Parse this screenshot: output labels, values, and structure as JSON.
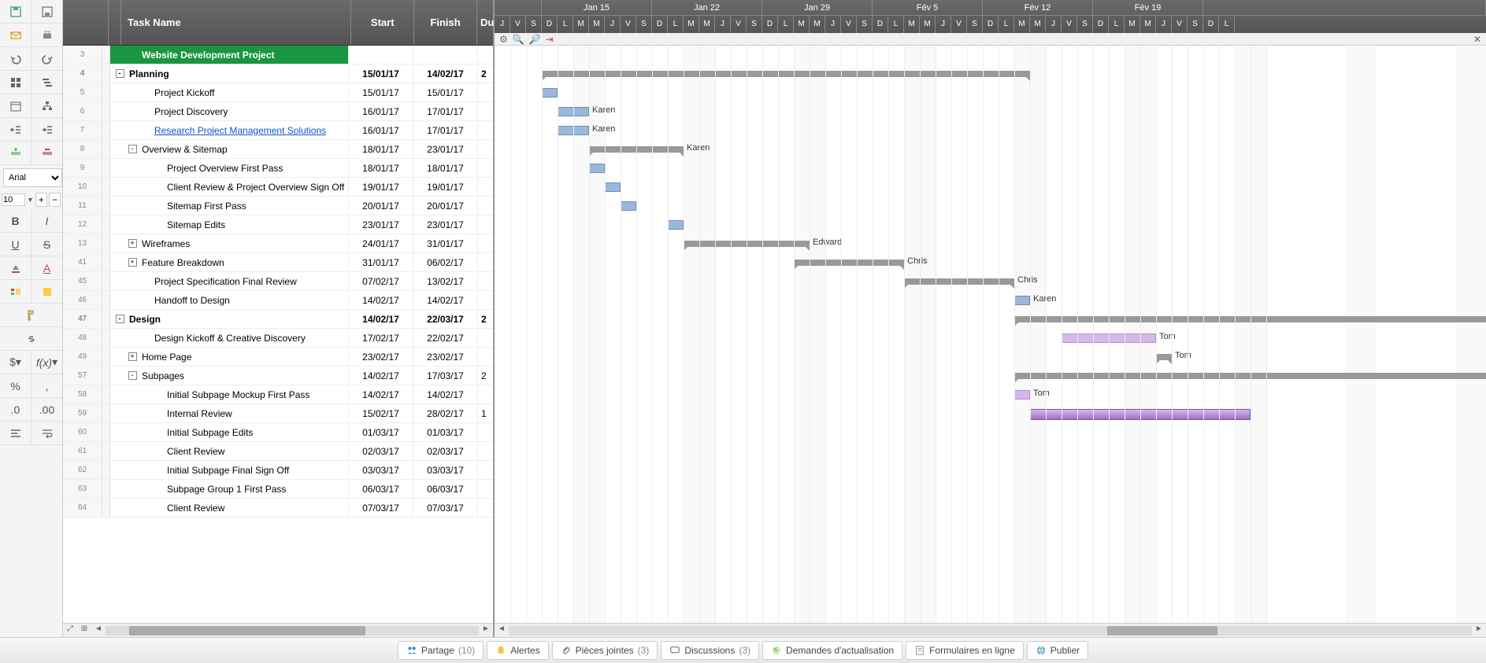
{
  "toolbar": {
    "font": "Arial",
    "size": "10"
  },
  "grid_headers": {
    "task": "Task Name",
    "start": "Start",
    "finish": "Finish",
    "duration": "Du"
  },
  "rows": [
    {
      "num": "3",
      "indent": 1,
      "title": true,
      "task": "Website Development Project",
      "start": "",
      "finish": "",
      "dur": ""
    },
    {
      "num": "4",
      "indent": 0,
      "bold": true,
      "expand": "-",
      "task": "Planning",
      "start": "15/01/17",
      "finish": "14/02/17",
      "dur": "2"
    },
    {
      "num": "5",
      "indent": 2,
      "task": "Project Kickoff",
      "start": "15/01/17",
      "finish": "15/01/17",
      "dur": ""
    },
    {
      "num": "6",
      "indent": 2,
      "task": "Project Discovery",
      "start": "16/01/17",
      "finish": "17/01/17",
      "dur": ""
    },
    {
      "num": "7",
      "indent": 2,
      "link": true,
      "task": "Research Project Management Solutions",
      "start": "16/01/17",
      "finish": "17/01/17",
      "dur": ""
    },
    {
      "num": "8",
      "indent": 1,
      "expand": "-",
      "task": "Overview & Sitemap",
      "start": "18/01/17",
      "finish": "23/01/17",
      "dur": ""
    },
    {
      "num": "9",
      "indent": 3,
      "task": "Project Overview First Pass",
      "start": "18/01/17",
      "finish": "18/01/17",
      "dur": ""
    },
    {
      "num": "10",
      "indent": 3,
      "task": "Client Review & Project Overview Sign Off",
      "start": "19/01/17",
      "finish": "19/01/17",
      "dur": ""
    },
    {
      "num": "11",
      "indent": 3,
      "task": "Sitemap First Pass",
      "start": "20/01/17",
      "finish": "20/01/17",
      "dur": ""
    },
    {
      "num": "12",
      "indent": 3,
      "task": "Sitemap Edits",
      "start": "23/01/17",
      "finish": "23/01/17",
      "dur": ""
    },
    {
      "num": "13",
      "indent": 1,
      "expand": "+",
      "task": "Wireframes",
      "start": "24/01/17",
      "finish": "31/01/17",
      "dur": ""
    },
    {
      "num": "41",
      "indent": 1,
      "expand": "+",
      "task": "Feature Breakdown",
      "start": "31/01/17",
      "finish": "06/02/17",
      "dur": ""
    },
    {
      "num": "45",
      "indent": 2,
      "task": "Project Specification Final Review",
      "start": "07/02/17",
      "finish": "13/02/17",
      "dur": ""
    },
    {
      "num": "46",
      "indent": 2,
      "task": "Handoff to Design",
      "start": "14/02/17",
      "finish": "14/02/17",
      "dur": ""
    },
    {
      "num": "47",
      "indent": 0,
      "bold": true,
      "expand": "-",
      "task": "Design",
      "start": "14/02/17",
      "finish": "22/03/17",
      "dur": "2"
    },
    {
      "num": "48",
      "indent": 2,
      "task": "Design Kickoff & Creative Discovery",
      "start": "17/02/17",
      "finish": "22/02/17",
      "dur": ""
    },
    {
      "num": "49",
      "indent": 1,
      "expand": "+",
      "task": "Home Page",
      "start": "23/02/17",
      "finish": "23/02/17",
      "dur": ""
    },
    {
      "num": "57",
      "indent": 1,
      "expand": "-",
      "task": "Subpages",
      "start": "14/02/17",
      "finish": "17/03/17",
      "dur": "2"
    },
    {
      "num": "58",
      "indent": 3,
      "task": "Initial Subpage Mockup First Pass",
      "start": "14/02/17",
      "finish": "14/02/17",
      "dur": ""
    },
    {
      "num": "59",
      "indent": 3,
      "task": "Internal Review",
      "start": "15/02/17",
      "finish": "28/02/17",
      "dur": "1"
    },
    {
      "num": "60",
      "indent": 3,
      "task": "Initial Subpage Edits",
      "start": "01/03/17",
      "finish": "01/03/17",
      "dur": ""
    },
    {
      "num": "61",
      "indent": 3,
      "task": "Client Review",
      "start": "02/03/17",
      "finish": "02/03/17",
      "dur": ""
    },
    {
      "num": "62",
      "indent": 3,
      "task": "Initial Subpage Final Sign Off",
      "start": "03/03/17",
      "finish": "03/03/17",
      "dur": ""
    },
    {
      "num": "63",
      "indent": 3,
      "task": "Subpage Group 1 First Pass",
      "start": "06/03/17",
      "finish": "06/03/17",
      "dur": ""
    },
    {
      "num": "64",
      "indent": 3,
      "task": "Client Review",
      "start": "07/03/17",
      "finish": "07/03/17",
      "dur": ""
    }
  ],
  "timeline": {
    "weeks": [
      "Jan 15",
      "Jan 22",
      "Jan 29",
      "Fév 5",
      "Fév 12",
      "Fév 19"
    ],
    "days": [
      "J",
      "V",
      "S",
      "D",
      "L",
      "M",
      "M",
      "J",
      "V",
      "S",
      "D",
      "L",
      "M",
      "M",
      "J",
      "V",
      "S",
      "D",
      "L",
      "M",
      "M",
      "J",
      "V",
      "S",
      "D",
      "L",
      "M",
      "M",
      "J",
      "V",
      "S",
      "D",
      "L",
      "M",
      "M",
      "J",
      "V",
      "S",
      "D",
      "L",
      "M",
      "M",
      "J",
      "V",
      "S",
      "D",
      "L"
    ]
  },
  "gantt_labels": {
    "karen": "Karen",
    "edward": "Edward",
    "chris": "Chris",
    "tom": "Tom"
  },
  "status_bar": {
    "partage": "Partage",
    "partage_count": "(10)",
    "alertes": "Alertes",
    "pieces": "Pièces jointes",
    "pieces_count": "(3)",
    "discussions": "Discussions",
    "discussions_count": "(3)",
    "demandes": "Demandes d'actualisation",
    "formulaires": "Formulaires en ligne",
    "publier": "Publier"
  },
  "chart_data": {
    "type": "gantt",
    "title": "Website Development Project",
    "date_range": [
      "2017-01-12",
      "2017-02-25"
    ],
    "tasks": [
      {
        "id": 4,
        "name": "Planning",
        "type": "summary",
        "start": "2017-01-15",
        "finish": "2017-02-14"
      },
      {
        "id": 5,
        "name": "Project Kickoff",
        "type": "task",
        "start": "2017-01-15",
        "finish": "2017-01-15"
      },
      {
        "id": 6,
        "name": "Project Discovery",
        "type": "task",
        "start": "2017-01-16",
        "finish": "2017-01-17",
        "assignee": "Karen"
      },
      {
        "id": 7,
        "name": "Research Project Management Solutions",
        "type": "task",
        "start": "2017-01-16",
        "finish": "2017-01-17",
        "assignee": "Karen"
      },
      {
        "id": 8,
        "name": "Overview & Sitemap",
        "type": "summary",
        "start": "2017-01-18",
        "finish": "2017-01-23",
        "assignee": "Karen"
      },
      {
        "id": 9,
        "name": "Project Overview First Pass",
        "type": "task",
        "start": "2017-01-18",
        "finish": "2017-01-18"
      },
      {
        "id": 10,
        "name": "Client Review & Project Overview Sign Off",
        "type": "task",
        "start": "2017-01-19",
        "finish": "2017-01-19"
      },
      {
        "id": 11,
        "name": "Sitemap First Pass",
        "type": "task",
        "start": "2017-01-20",
        "finish": "2017-01-20"
      },
      {
        "id": 12,
        "name": "Sitemap Edits",
        "type": "task",
        "start": "2017-01-23",
        "finish": "2017-01-23"
      },
      {
        "id": 13,
        "name": "Wireframes",
        "type": "summary",
        "start": "2017-01-24",
        "finish": "2017-01-31",
        "assignee": "Edward"
      },
      {
        "id": 41,
        "name": "Feature Breakdown",
        "type": "summary",
        "start": "2017-01-31",
        "finish": "2017-02-06",
        "assignee": "Chris"
      },
      {
        "id": 45,
        "name": "Project Specification Final Review",
        "type": "summary",
        "start": "2017-02-07",
        "finish": "2017-02-13",
        "assignee": "Chris"
      },
      {
        "id": 46,
        "name": "Handoff to Design",
        "type": "task",
        "start": "2017-02-14",
        "finish": "2017-02-14",
        "assignee": "Karen"
      },
      {
        "id": 47,
        "name": "Design",
        "type": "summary",
        "start": "2017-02-14",
        "finish": "2017-03-22"
      },
      {
        "id": 48,
        "name": "Design Kickoff & Creative Discovery",
        "type": "task",
        "start": "2017-02-17",
        "finish": "2017-02-22",
        "assignee": "Tom",
        "color": "purple"
      },
      {
        "id": 49,
        "name": "Home Page",
        "type": "summary",
        "start": "2017-02-23",
        "finish": "2017-02-23",
        "assignee": "Tom"
      },
      {
        "id": 57,
        "name": "Subpages",
        "type": "summary",
        "start": "2017-02-14",
        "finish": "2017-03-17"
      },
      {
        "id": 58,
        "name": "Initial Subpage Mockup First Pass",
        "type": "task",
        "start": "2017-02-14",
        "finish": "2017-02-14",
        "assignee": "Tom",
        "color": "purple"
      },
      {
        "id": 59,
        "name": "Internal Review",
        "type": "task",
        "start": "2017-02-15",
        "finish": "2017-02-28",
        "color": "purple"
      }
    ]
  }
}
